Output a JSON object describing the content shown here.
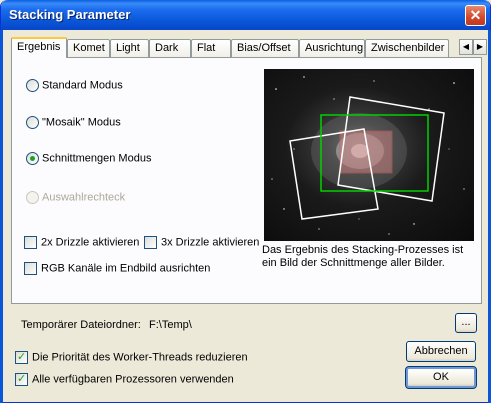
{
  "window": {
    "title": "Stacking Parameter",
    "close_glyph": "✕"
  },
  "tabs": [
    {
      "label": "Ergebnis"
    },
    {
      "label": "Komet"
    },
    {
      "label": "Light"
    },
    {
      "label": "Dark"
    },
    {
      "label": "Flat"
    },
    {
      "label": "Bias/Offset"
    },
    {
      "label": "Ausrichtung"
    },
    {
      "label": "Zwischenbilder"
    }
  ],
  "tab_scroll": {
    "left": "◀",
    "right": "▶"
  },
  "modes": [
    {
      "label": "Standard Modus",
      "checked": false,
      "disabled": false
    },
    {
      "label": "\"Mosaik\" Modus",
      "checked": false,
      "disabled": false
    },
    {
      "label": "Schnittmengen Modus",
      "checked": true,
      "disabled": false
    },
    {
      "label": "Auswahlrechteck",
      "checked": false,
      "disabled": true
    }
  ],
  "options": {
    "drizzle2x": {
      "label": "2x Drizzle aktivieren",
      "checked": false
    },
    "drizzle3x": {
      "label": "3x Drizzle aktivieren",
      "checked": false
    },
    "rgb_align": {
      "label": "RGB Kanäle im Endbild ausrichten",
      "checked": false
    }
  },
  "preview": {
    "description": "Das Ergebnis des Stacking-Prozesses ist ein Bild der Schnittmenge aller Bilder."
  },
  "temp_folder": {
    "label": "Temporärer Dateiordner:",
    "value": "F:\\Temp\\",
    "browse_label": "..."
  },
  "footer": {
    "reduce_priority": {
      "label": "Die Priorität des Worker-Threads reduzieren",
      "checked": true
    },
    "use_all_cpus": {
      "label": "Alle verfügbaren Prozessoren verwenden",
      "checked": true
    },
    "cancel_label": "Abbrechen",
    "ok_label": "OK"
  },
  "colors": {
    "titlebar": "#0a56d8",
    "intersection_frame": "#00d000",
    "image_frames": "#ffffff",
    "overlap_fill": "#c88080"
  }
}
